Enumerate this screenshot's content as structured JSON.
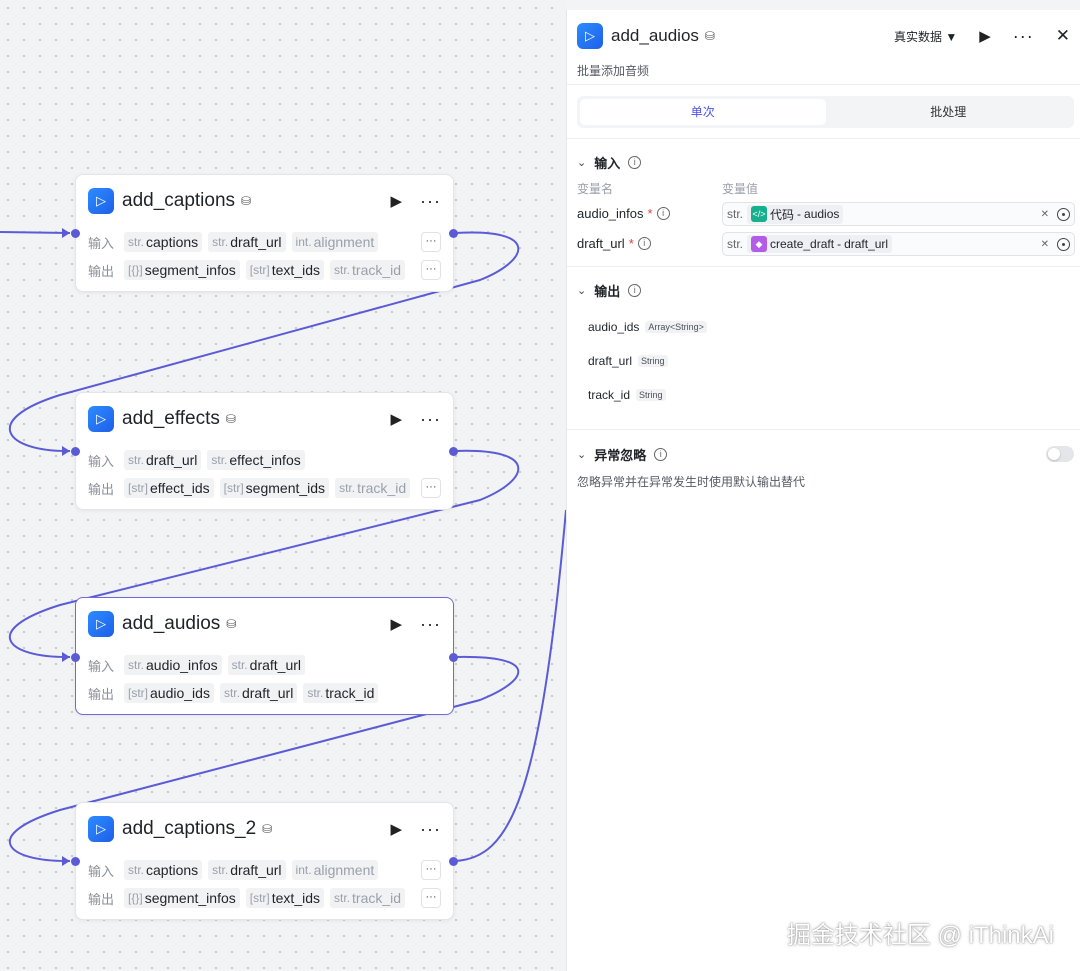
{
  "canvas": {
    "nodes": [
      {
        "title": "add_captions",
        "input_label": "输入",
        "output_label": "输出",
        "inputs": [
          {
            "type": "str.",
            "name": "captions"
          },
          {
            "type": "str.",
            "name": "draft_url"
          },
          {
            "type": "int.",
            "name": "alignment"
          }
        ],
        "outputs": [
          {
            "type": "[{}]",
            "name": "segment_infos"
          },
          {
            "type": "[str]",
            "name": "text_ids"
          },
          {
            "type": "str.",
            "name": "track_id"
          }
        ],
        "more": "···"
      },
      {
        "title": "add_effects",
        "input_label": "输入",
        "output_label": "输出",
        "inputs": [
          {
            "type": "str.",
            "name": "draft_url"
          },
          {
            "type": "str.",
            "name": "effect_infos"
          }
        ],
        "outputs": [
          {
            "type": "[str]",
            "name": "effect_ids"
          },
          {
            "type": "[str]",
            "name": "segment_ids"
          },
          {
            "type": "str.",
            "name": "track_id"
          }
        ],
        "more": "···"
      },
      {
        "title": "add_audios",
        "input_label": "输入",
        "output_label": "输出",
        "inputs": [
          {
            "type": "str.",
            "name": "audio_infos"
          },
          {
            "type": "str.",
            "name": "draft_url"
          }
        ],
        "outputs": [
          {
            "type": "[str]",
            "name": "audio_ids"
          },
          {
            "type": "str.",
            "name": "draft_url"
          },
          {
            "type": "str.",
            "name": "track_id"
          }
        ]
      },
      {
        "title": "add_captions_2",
        "input_label": "输入",
        "output_label": "输出",
        "inputs": [
          {
            "type": "str.",
            "name": "captions"
          },
          {
            "type": "str.",
            "name": "draft_url"
          },
          {
            "type": "int.",
            "name": "alignment"
          }
        ],
        "outputs": [
          {
            "type": "[{}]",
            "name": "segment_infos"
          },
          {
            "type": "[str]",
            "name": "text_ids"
          },
          {
            "type": "str.",
            "name": "track_id"
          }
        ],
        "more": "···"
      }
    ]
  },
  "panel": {
    "title": "add_audios",
    "data_mode": "真实数据",
    "description": "批量添加音频",
    "tabs": [
      "单次",
      "批处理"
    ],
    "input_section": {
      "title": "输入",
      "col_name": "变量名",
      "col_value": "变量值",
      "vars": [
        {
          "name": "audio_infos",
          "required": "*",
          "type": "str.",
          "source": "代码",
          "sep": "-",
          "field": "audios",
          "icon_color": "#17b08f"
        },
        {
          "name": "draft_url",
          "required": "*",
          "type": "str.",
          "source": "create_draft",
          "sep": "-",
          "field": "draft_url",
          "icon_color": "#b25ce8"
        }
      ]
    },
    "output_section": {
      "title": "输出",
      "outputs": [
        {
          "name": "audio_ids",
          "type": "Array<String>"
        },
        {
          "name": "draft_url",
          "type": "String"
        },
        {
          "name": "track_id",
          "type": "String"
        }
      ]
    },
    "error_section": {
      "title": "异常忽略",
      "description": "忽略异常并在异常发生时使用默认输出替代",
      "enabled": false
    }
  },
  "watermark": "掘金技术社区 @ iThinkAi",
  "colors": {
    "accent": "#4d53e8",
    "wire": "#5b5bd6",
    "node_icon": "#2d8cff"
  }
}
